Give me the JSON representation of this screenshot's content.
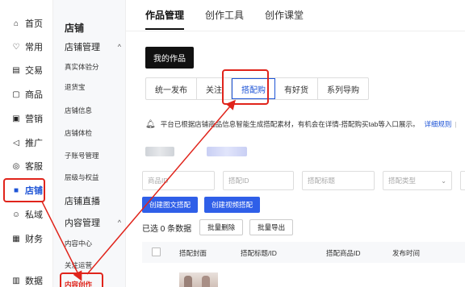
{
  "rail": {
    "items": [
      {
        "label": "首页",
        "icon": "home-icon"
      },
      {
        "label": "常用",
        "icon": "heart-icon"
      },
      {
        "label": "交易",
        "icon": "orders-icon"
      },
      {
        "label": "商品",
        "icon": "goods-icon"
      },
      {
        "label": "营销",
        "icon": "marketing-icon"
      },
      {
        "label": "推广",
        "icon": "promotion-icon"
      },
      {
        "label": "客服",
        "icon": "service-icon"
      },
      {
        "label": "店铺",
        "icon": "shop-icon"
      },
      {
        "label": "私域",
        "icon": "private-domain-icon"
      },
      {
        "label": "财务",
        "icon": "finance-icon"
      },
      {
        "label": "数据",
        "icon": "data-icon"
      }
    ],
    "active": "店铺"
  },
  "subnav": {
    "title": "店铺",
    "groups": [
      {
        "label": "店铺管理",
        "chevron": "^"
      },
      {
        "label": "店铺直播"
      },
      {
        "label": "内容管理",
        "chevron": "^"
      }
    ],
    "shop_items": [
      "真实体验分",
      "退货宝",
      "店铺信息",
      "店铺体检",
      "子账号管理",
      "层级与权益"
    ],
    "content_items": [
      "内容中心",
      "关注运营",
      "内容创作"
    ]
  },
  "main": {
    "tabs": [
      "作品管理",
      "创作工具",
      "创作课堂"
    ],
    "active_tab": "作品管理",
    "my_works_button": "我的作品",
    "segments": [
      "统一发布",
      "关注",
      "搭配购",
      "有好货",
      "系列导购"
    ],
    "active_segment": "搭配购",
    "notice": {
      "text": "平台已根据店铺商品信息智能生成搭配素材，有机会在详情-搭配购买tab等入口展示。",
      "link": "详细规则",
      "trail": "丰"
    },
    "filters": [
      {
        "placeholder": "商品ID"
      },
      {
        "placeholder": "搭配ID"
      },
      {
        "placeholder": "搭配标题"
      },
      {
        "placeholder": "搭配类型",
        "dropdown": true
      }
    ],
    "actions": [
      "创建图文搭配",
      "创建视频搭配"
    ],
    "selection": {
      "text": "已选 0 条数据",
      "buttons": [
        "批量删除",
        "批量导出"
      ]
    },
    "table_headers": [
      "搭配封面",
      "搭配标题/ID",
      "搭配商品ID",
      "发布时间"
    ]
  },
  "colors": {
    "accent": "#1e54d6",
    "annotation_red": "#e0241b",
    "dark_button": "#111111"
  }
}
